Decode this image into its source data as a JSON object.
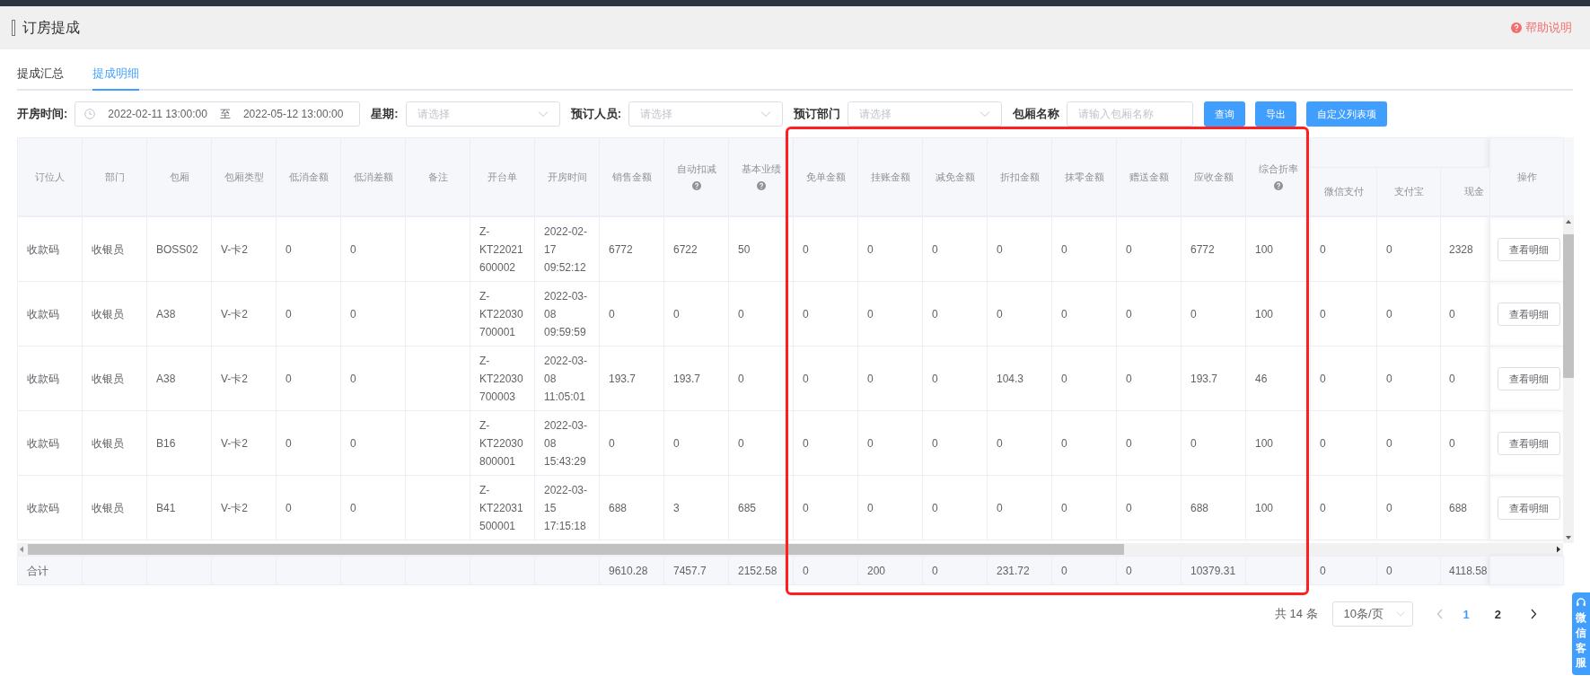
{
  "page": {
    "title": "订房提成",
    "help": "帮助说明"
  },
  "tabs": [
    {
      "label": "提成汇总",
      "selected": false
    },
    {
      "label": "提成明细",
      "selected": true
    }
  ],
  "filters": [
    {
      "kind": "daterange",
      "label": "开房时间:",
      "start": "2022-02-11 13:00:00",
      "separator": "至",
      "end": "2022-05-12 13:00:00"
    },
    {
      "kind": "select",
      "label": "星期:",
      "placeholder": "请选择"
    },
    {
      "kind": "select",
      "label": "预订人员:",
      "placeholder": "请选择"
    },
    {
      "kind": "select",
      "label": "预订部门",
      "placeholder": "请选择"
    },
    {
      "kind": "input",
      "label": "包厢名称",
      "placeholder": "请输入包厢名称"
    }
  ],
  "buttons": [
    "查询",
    "导出",
    "自定义列表项"
  ],
  "table": {
    "columns": [
      {
        "label": "订位人",
        "help": false,
        "grouped": false
      },
      {
        "label": "部门",
        "help": false,
        "grouped": false
      },
      {
        "label": "包厢",
        "help": false,
        "grouped": false
      },
      {
        "label": "包厢类型",
        "help": false,
        "grouped": false
      },
      {
        "label": "低消金额",
        "help": false,
        "grouped": false
      },
      {
        "label": "低消差额",
        "help": false,
        "grouped": false
      },
      {
        "label": "备注",
        "help": false,
        "grouped": false
      },
      {
        "label": "开台单",
        "help": false,
        "grouped": false
      },
      {
        "label": "开房时间",
        "help": false,
        "grouped": false
      },
      {
        "label": "销售金额",
        "help": false,
        "grouped": false
      },
      {
        "label": "自动扣减",
        "help": true,
        "grouped": false
      },
      {
        "label": "基本业绩",
        "help": true,
        "grouped": false
      },
      {
        "label": "免单金额",
        "help": false,
        "grouped": false
      },
      {
        "label": "挂账金额",
        "help": false,
        "grouped": false
      },
      {
        "label": "减免金额",
        "help": false,
        "grouped": false
      },
      {
        "label": "折扣金额",
        "help": false,
        "grouped": false
      },
      {
        "label": "抹零金额",
        "help": false,
        "grouped": false
      },
      {
        "label": "赠送金额",
        "help": false,
        "grouped": false
      },
      {
        "label": "应收金额",
        "help": false,
        "grouped": false
      },
      {
        "label": "综合折率",
        "help": true,
        "grouped": false
      },
      {
        "label": "微信支付",
        "help": false,
        "grouped": true
      },
      {
        "label": "支付宝",
        "help": false,
        "grouped": true
      },
      {
        "label": "现金",
        "help": false,
        "grouped": true
      }
    ],
    "action_column": "操作",
    "rows": [
      {
        "cells": [
          "收款码",
          "收银员",
          "BOSS02",
          "V-卡2",
          "0",
          "0",
          "",
          "Z-KT22021600002",
          "2022-02-17 09:52:12",
          "6772",
          "6722",
          "50",
          "0",
          "0",
          "0",
          "0",
          "0",
          "0",
          "6772",
          "100",
          "0",
          "0",
          "2328"
        ],
        "action": "查看明细"
      },
      {
        "cells": [
          "收款码",
          "收银员",
          "A38",
          "V-卡2",
          "0",
          "0",
          "",
          "Z-KT22030700001",
          "2022-03-08 09:59:59",
          "0",
          "0",
          "0",
          "0",
          "0",
          "0",
          "0",
          "0",
          "0",
          "0",
          "100",
          "0",
          "0",
          "0"
        ],
        "action": "查看明细"
      },
      {
        "cells": [
          "收款码",
          "收银员",
          "A38",
          "V-卡2",
          "0",
          "0",
          "",
          "Z-KT22030700003",
          "2022-03-08 11:05:01",
          "193.7",
          "193.7",
          "0",
          "0",
          "0",
          "0",
          "104.3",
          "0",
          "0",
          "193.7",
          "46",
          "0",
          "0",
          "0"
        ],
        "action": "查看明细"
      },
      {
        "cells": [
          "收款码",
          "收银员",
          "B16",
          "V-卡2",
          "0",
          "0",
          "",
          "Z-KT22030800001",
          "2022-03-08 15:43:29",
          "0",
          "0",
          "0",
          "0",
          "0",
          "0",
          "0",
          "0",
          "0",
          "0",
          "100",
          "0",
          "0",
          "0"
        ],
        "action": "查看明细"
      },
      {
        "cells": [
          "收款码",
          "收银员",
          "B41",
          "V-卡2",
          "0",
          "0",
          "",
          "Z-KT22031500001",
          "2022-03-15 17:15:18",
          "688",
          "3",
          "685",
          "0",
          "0",
          "0",
          "0",
          "0",
          "0",
          "688",
          "100",
          "0",
          "0",
          "688"
        ],
        "action": "查看明细"
      }
    ],
    "totals": [
      {
        "kind": "label",
        "text": "合计"
      },
      {
        "kind": "empty"
      },
      {
        "kind": "empty"
      },
      {
        "kind": "empty"
      },
      {
        "kind": "empty"
      },
      {
        "kind": "empty"
      },
      {
        "kind": "empty"
      },
      {
        "kind": "empty"
      },
      {
        "kind": "empty"
      },
      {
        "kind": "value",
        "text": "9610.28"
      },
      {
        "kind": "value",
        "text": "7457.7"
      },
      {
        "kind": "value",
        "text": "2152.58"
      },
      {
        "kind": "value",
        "text": "0"
      },
      {
        "kind": "value",
        "text": "200"
      },
      {
        "kind": "value",
        "text": "0"
      },
      {
        "kind": "value",
        "text": "231.72"
      },
      {
        "kind": "value",
        "text": "0"
      },
      {
        "kind": "value",
        "text": "0"
      },
      {
        "kind": "value",
        "text": "10379.31"
      },
      {
        "kind": "empty"
      },
      {
        "kind": "value",
        "text": "0"
      },
      {
        "kind": "value",
        "text": "0"
      },
      {
        "kind": "value",
        "text": "4118.58"
      }
    ]
  },
  "pagination": {
    "total": "共 14 条",
    "page_size": "10条/页",
    "pages": [
      {
        "label": "1",
        "selected": true
      },
      {
        "label": "2",
        "selected": false
      }
    ]
  },
  "support": "微信客服"
}
